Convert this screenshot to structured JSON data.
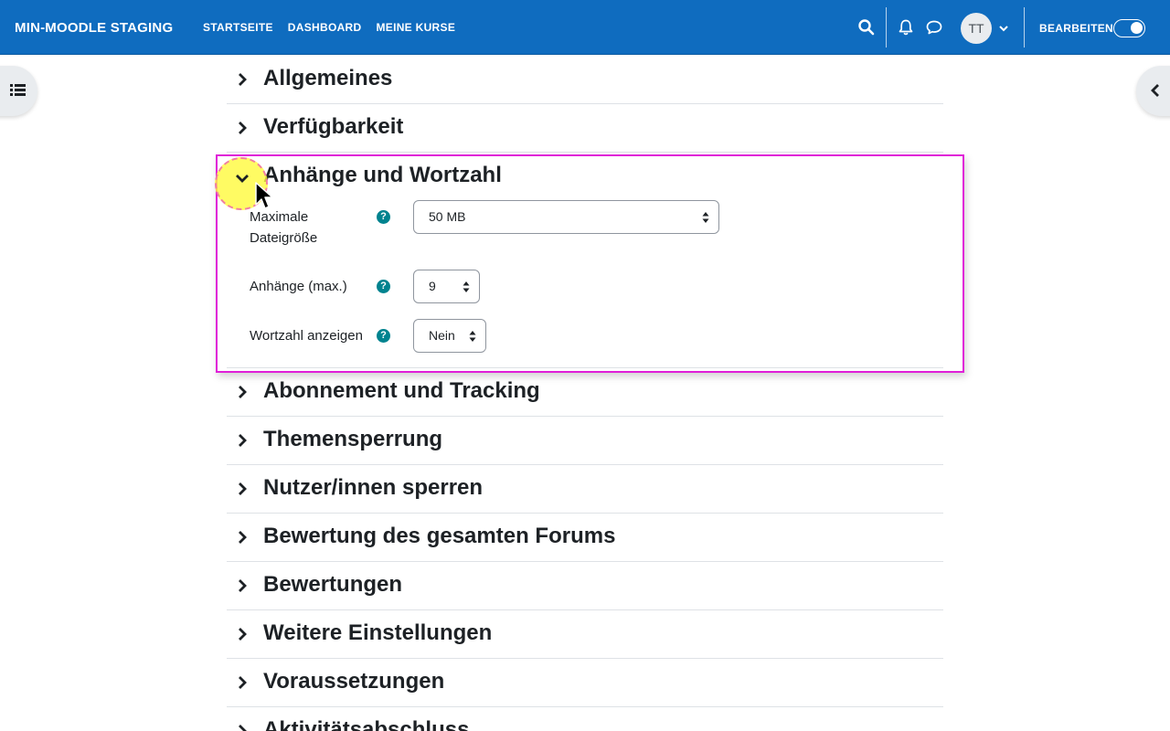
{
  "navbar": {
    "brand": "MIN-MOODLE STAGING",
    "links": [
      "STARTSEITE",
      "DASHBOARD",
      "MEINE KURSE"
    ],
    "avatar_initials": "TT",
    "edit_label": "BEARBEITEN",
    "edit_mode_on": true
  },
  "sections": {
    "general": "Allgemeines",
    "availability": "Verfügbarkeit",
    "attachments": "Anhänge und Wortzahl",
    "subscription": "Abonnement und Tracking",
    "thread_lock": "Themensperrung",
    "user_block": "Nutzer/innen sperren",
    "whole_forum_grade": "Bewertung des gesamten Forums",
    "ratings": "Bewertungen",
    "more_settings": "Weitere Einstellungen",
    "restrictions": "Voraussetzungen",
    "completion": "Aktivitätsabschluss"
  },
  "attachments_form": {
    "max_size_label_line1": "Maximale",
    "max_size_label_line2": "Dateigröße",
    "max_size_value": "50 MB",
    "max_attachments_label": "Anhänge (max.)",
    "max_attachments_value": "9",
    "word_count_label": "Wortzahl anzeigen",
    "word_count_value": "Nein",
    "help_glyph": "?"
  },
  "colors": {
    "navbar": "#0f6cbf",
    "highlight_border": "#e020d8",
    "help_icon": "#00838f"
  }
}
